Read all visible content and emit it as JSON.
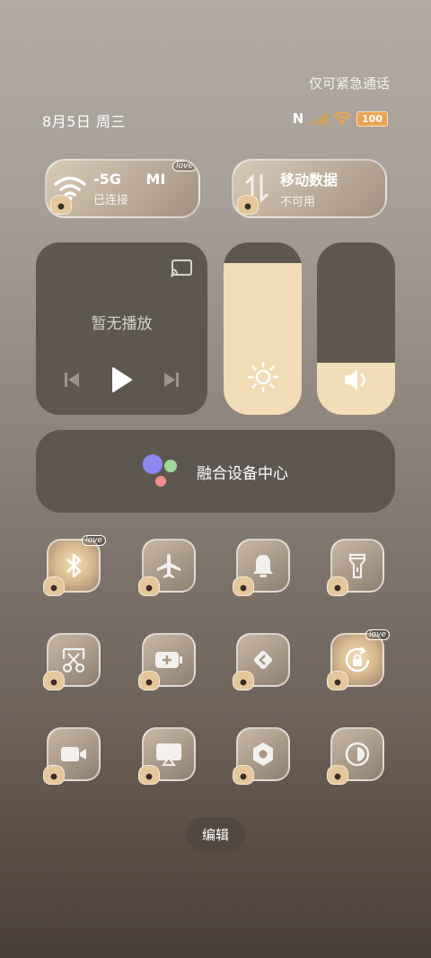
{
  "status": {
    "emergency": "仅可紧急通话",
    "date": "8月5日 周三",
    "nfc": "N",
    "battery": "100"
  },
  "wifi": {
    "title": "-5G",
    "title_tail": "MI",
    "subtitle": "已连接",
    "love": "love"
  },
  "mobile_data": {
    "title": "移动数据",
    "subtitle": "不可用"
  },
  "media": {
    "label": "暂无播放"
  },
  "brightness": {
    "level": 0.88
  },
  "volume": {
    "level": 0.3
  },
  "device_center": {
    "label": "融合设备中心"
  },
  "toggles": [
    {
      "name": "bluetooth",
      "icon": "bluetooth-icon",
      "active": true,
      "love": "love"
    },
    {
      "name": "airplane-mode",
      "icon": "airplane-icon",
      "active": false
    },
    {
      "name": "silent",
      "icon": "bell-icon",
      "active": false
    },
    {
      "name": "flashlight",
      "icon": "flashlight-icon",
      "active": false
    },
    {
      "name": "screenshot",
      "icon": "scissors-icon",
      "active": false
    },
    {
      "name": "battery-saver",
      "icon": "battery-plus-icon",
      "active": false
    },
    {
      "name": "remote-connect",
      "icon": "link-icon",
      "active": false
    },
    {
      "name": "auto-rotate-lock",
      "icon": "rotate-lock-icon",
      "active": true,
      "love": "love"
    },
    {
      "name": "screen-record",
      "icon": "video-icon",
      "active": false
    },
    {
      "name": "screen-cast",
      "icon": "cast-screen-icon",
      "active": false
    },
    {
      "name": "settings",
      "icon": "hexagon-icon",
      "active": false
    },
    {
      "name": "dark-mode",
      "icon": "dark-mode-icon",
      "active": false
    }
  ],
  "edit": {
    "label": "编辑"
  }
}
